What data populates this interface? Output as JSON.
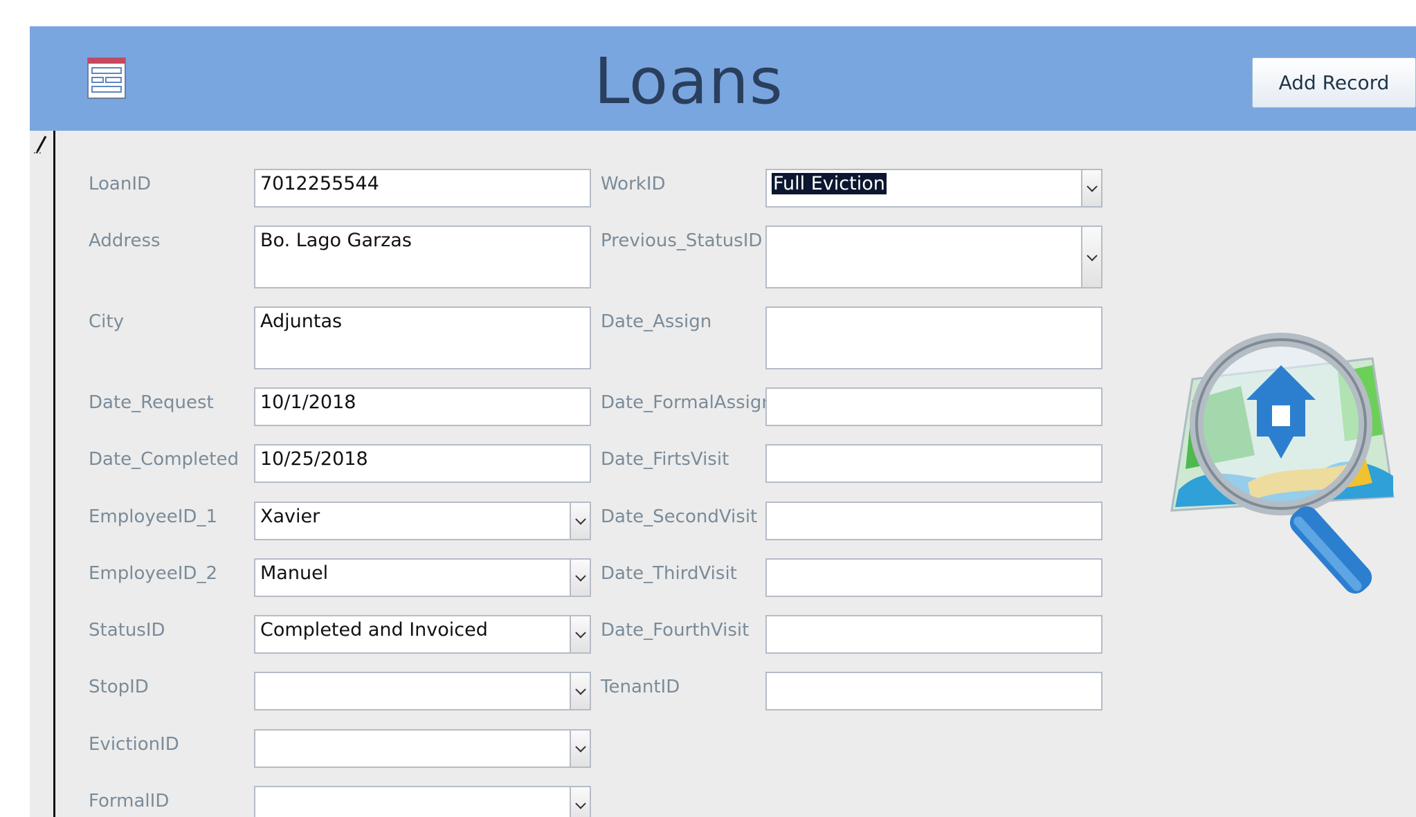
{
  "header": {
    "title": "Loans",
    "add_record_label": "Add Record",
    "form_icon": "form-icon",
    "color": "#7aa6e0"
  },
  "record_selector": {
    "icon": "pencil-edit-icon"
  },
  "fields_left": [
    {
      "label": "LoanID",
      "value": "7012255544",
      "type": "text"
    },
    {
      "label": "Address",
      "value": "Bo. Lago Garzas",
      "type": "text"
    },
    {
      "label": "City",
      "value": "Adjuntas",
      "type": "text"
    },
    {
      "label": "Date_Request",
      "value": "10/1/2018",
      "type": "text"
    },
    {
      "label": "Date_Completed",
      "value": "10/25/2018",
      "type": "text"
    },
    {
      "label": "EmployeeID_1",
      "value": "Xavier",
      "type": "combo"
    },
    {
      "label": "EmployeeID_2",
      "value": "Manuel",
      "type": "combo"
    },
    {
      "label": "StatusID",
      "value": "Completed and Invoiced",
      "type": "combo"
    },
    {
      "label": "StopID",
      "value": "",
      "type": "combo"
    },
    {
      "label": "EvictionID",
      "value": "",
      "type": "combo"
    },
    {
      "label": "FormalID",
      "value": "",
      "type": "combo"
    }
  ],
  "fields_right": [
    {
      "label": "WorkID",
      "value": "Full Eviction",
      "type": "combo"
    },
    {
      "label": "Previous_StatusID",
      "value": "",
      "type": "combo"
    },
    {
      "label": "Date_Assign",
      "value": "",
      "type": "text"
    },
    {
      "label": "Date_FormalAssign",
      "value": "",
      "type": "text"
    },
    {
      "label": "Date_FirtsVisit",
      "value": "",
      "type": "text"
    },
    {
      "label": "Date_SecondVisit",
      "value": "",
      "type": "text"
    },
    {
      "label": "Date_ThirdVisit",
      "value": "",
      "type": "text"
    },
    {
      "label": "Date_FourthVisit",
      "value": "",
      "type": "text"
    },
    {
      "label": "TenantID",
      "value": "",
      "type": "text"
    }
  ],
  "image": {
    "icon": "property-search-magnifier-icon"
  },
  "colors": {
    "form_background": "#ececec",
    "label_text": "#7a8b99",
    "title_text": "#2a3f5d",
    "selection_highlight": "#0b1630"
  }
}
